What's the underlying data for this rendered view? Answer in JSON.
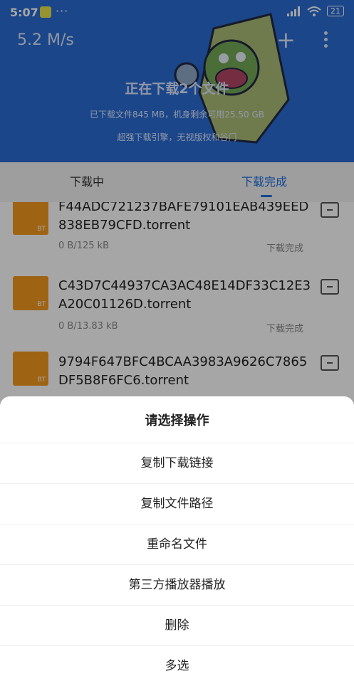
{
  "status_bar": {
    "time": "5:07",
    "dots": "···",
    "battery": "21"
  },
  "header": {
    "speed": "5.2 M/s",
    "add_label": "+",
    "title": "正在下载2个文件",
    "subtitle": "已下载文件845 MB，机身剩余可用25.50 GB",
    "tagline": "超强下载引擎，无视版权和谷门"
  },
  "tabs": [
    {
      "label": "下载中"
    },
    {
      "label": "下载完成"
    }
  ],
  "files": [
    {
      "name": "F44ADC721237BAFE79101EAB439EED838EB79CFD.torrent",
      "size": "0 B/125 kB",
      "status": "下载完成",
      "badge": "BT"
    },
    {
      "name": "C43D7C44937CA3AC48E14DF33C12E3A20C01126D.torrent",
      "size": "0 B/13.83 kB",
      "status": "下载完成",
      "badge": "BT"
    },
    {
      "name": "9794F647BFC4BCAA3983A9626C7865DF5B8F6FC6.torrent",
      "size": "",
      "status": "",
      "badge": "BT"
    }
  ],
  "sheet": {
    "title": "请选择操作",
    "options": [
      {
        "label": "复制下载链接"
      },
      {
        "label": "复制文件路径"
      },
      {
        "label": "重命名文件"
      },
      {
        "label": "第三方播放器播放"
      },
      {
        "label": "删除"
      },
      {
        "label": "多选"
      }
    ]
  },
  "colors": {
    "header_bg": "#2a6cd4",
    "accent": "#1e6de0",
    "file_icon": "#f39a1e"
  },
  "icons": {
    "app": "app-icon",
    "signal": "signal-icon",
    "wifi": "wifi-icon",
    "battery": "battery-icon",
    "add": "plus-icon",
    "more": "more-vertical-icon",
    "folder": "folder-icon"
  }
}
